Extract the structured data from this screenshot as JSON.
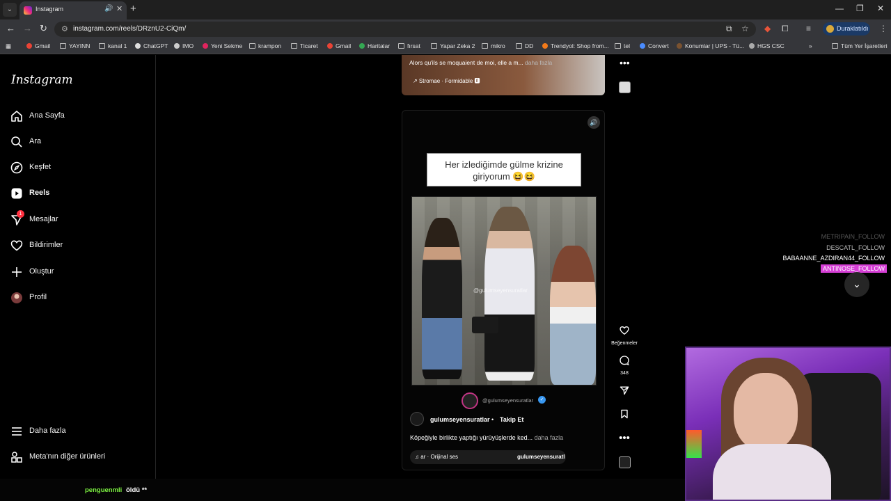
{
  "browser": {
    "tab_title": "Instagram",
    "url": "instagram.com/reels/DRznU2-CiQm/",
    "profile_status": "Duraklatıldı",
    "bookmarks": [
      "Gmail",
      "YAYINN",
      "kanal 1",
      "ChatGPT",
      "IMO",
      "Yeni Sekme",
      "krampon",
      "Ticaret",
      "Gmail",
      "Haritalar",
      "fırsat",
      "Yapar Zeka 2",
      "mikro",
      "DD",
      "Trendyol: Shop from...",
      "tel",
      "Convert",
      "Konumlar | UPS - Tü...",
      "HGS CSC"
    ],
    "all_bookmarks": "Tüm Yer İşaretleri"
  },
  "sidebar": {
    "logo": "Instagram",
    "items": [
      {
        "label": "Ana Sayfa",
        "icon": "home-icon"
      },
      {
        "label": "Ara",
        "icon": "search-icon"
      },
      {
        "label": "Keşfet",
        "icon": "compass-icon"
      },
      {
        "label": "Reels",
        "icon": "reels-icon"
      },
      {
        "label": "Mesajlar",
        "icon": "messenger-icon",
        "badge": "1"
      },
      {
        "label": "Bildirimler",
        "icon": "heart-icon"
      },
      {
        "label": "Oluştur",
        "icon": "plus-icon"
      },
      {
        "label": "Profil",
        "icon": "avatar-icon"
      }
    ],
    "more": "Daha fazla",
    "meta": "Meta'nın diğer ürünleri"
  },
  "prev_reel": {
    "caption": "Alors qu'ils se moquaient de moi, elle a m...",
    "more": "daha fazla",
    "music": "↗ Stromae · Formidable 🅴"
  },
  "reel": {
    "overlay_text_line1": "Her izlediğimde gülme krizine",
    "overlay_text_line2": "giriyorum 😆😆",
    "video_watermark": "@gulumseyensuratlar",
    "handle_watermark": "@gulumseyensuratlar",
    "author": "gulumseyensuratlar",
    "follow": "Takip Et",
    "description": "Köpeğiyle birlikte yaptığı yürüyüşlerde ked...",
    "more": "daha fazla",
    "music_left": "♫ ar · Orijinal ses",
    "music_right": "gulumseyensuratl"
  },
  "actions": {
    "likes_label": "Beğenmeler",
    "comments_count": "348"
  },
  "stream": {
    "alerts": [
      {
        "text": "METRIPAIN_FOLLOW",
        "color": "#555555"
      },
      {
        "text": "DESCATL_FOLLOW",
        "color": "#bbbbbb"
      },
      {
        "text": "BABAANNE_AZDIRAN44_FOLLOW",
        "color": "#ffffff"
      },
      {
        "text": "ANTINOSE_FOLLOW",
        "color": "#ffffff",
        "bg": "#d63fd6"
      }
    ],
    "chat_user": "penguenmli",
    "chat_message": "öldü **"
  }
}
